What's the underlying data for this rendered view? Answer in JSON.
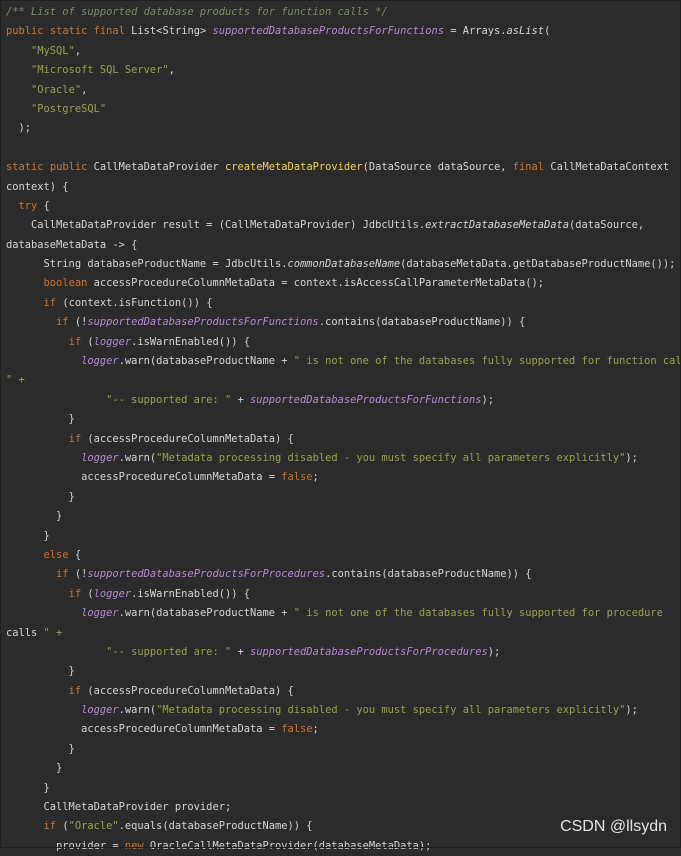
{
  "code_lines": [
    "/** List of supported database products for function calls */",
    "public static final List<String> supportedDatabaseProductsForFunctions = Arrays.asList(",
    "    \"MySQL\",",
    "    \"Microsoft SQL Server\",",
    "    \"Oracle\",",
    "    \"PostgreSQL\"",
    "  );",
    "",
    "static public CallMetaDataProvider createMetaDataProvider(DataSource dataSource, final CallMetaDataContext",
    "context) {",
    "  try {",
    "    CallMetaDataProvider result = (CallMetaDataProvider) JdbcUtils.extractDatabaseMetaData(dataSource,",
    "databaseMetaData -> {",
    "      String databaseProductName = JdbcUtils.commonDatabaseName(databaseMetaData.getDatabaseProductName());",
    "      boolean accessProcedureColumnMetaData = context.isAccessCallParameterMetaData();",
    "      if (context.isFunction()) {",
    "        if (!supportedDatabaseProductsForFunctions.contains(databaseProductName)) {",
    "          if (logger.isWarnEnabled()) {",
    "            logger.warn(databaseProductName + \" is not one of the databases fully supported for function calls",
    "\" +",
    "                \"-- supported are: \" + supportedDatabaseProductsForFunctions);",
    "          }",
    "          if (accessProcedureColumnMetaData) {",
    "            logger.warn(\"Metadata processing disabled - you must specify all parameters explicitly\");",
    "            accessProcedureColumnMetaData = false;",
    "          }",
    "        }",
    "      }",
    "      else {",
    "        if (!supportedDatabaseProductsForProcedures.contains(databaseProductName)) {",
    "          if (logger.isWarnEnabled()) {",
    "            logger.warn(databaseProductName + \" is not one of the databases fully supported for procedure",
    "calls \" +",
    "                \"-- supported are: \" + supportedDatabaseProductsForProcedures);",
    "          }",
    "          if (accessProcedureColumnMetaData) {",
    "            logger.warn(\"Metadata processing disabled - you must specify all parameters explicitly\");",
    "            accessProcedureColumnMetaData = false;",
    "          }",
    "        }",
    "      }",
    "      CallMetaDataProvider provider;",
    "      if (\"Oracle\".equals(databaseProductName)) {",
    "        provider = new OracleCallMetaDataProvider(databaseMetaData);"
  ],
  "watermark": "CSDN @llsydn",
  "colors": {
    "background": "#2b2b2b",
    "comment": "#7f8f6b",
    "keyword": "#cc7832",
    "string": "#9da34f",
    "method_decl": "#f8d25a",
    "static_field": "#b98ad8",
    "text": "#d7d7d7"
  }
}
